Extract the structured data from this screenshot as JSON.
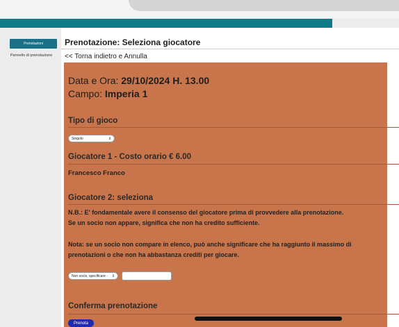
{
  "sidebar": {
    "button_label": "Prenotazioni",
    "link_label": "Pannello di prenotazione"
  },
  "main": {
    "title": "Prenotazione: Seleziona giocatore",
    "back_link": "<< Torna indietro e Annulla"
  },
  "booking": {
    "date_label": "Data e Ora: ",
    "date_value": "29/10/2024 H. 13.00",
    "campo_label": "Campo: ",
    "campo_value": "Imperia 1"
  },
  "tipo_gioco": {
    "heading": "Tipo di gioco",
    "selected": "Singolo"
  },
  "giocatore1": {
    "heading": "Giocatore 1 - Costo orario € 6.00",
    "name": "Francesco Franco"
  },
  "giocatore2": {
    "heading": "Giocatore 2: seleziona",
    "note1_line1": "N.B.: E' fondamentale avere il consenso del giocatore prima di provvedere alla prenotazione.",
    "note1_line2": "Se un socio non appare, significa che non ha credito sufficiente.",
    "note2_line1": "Nota: se un socio non compare in elenco, può anche significare che ha raggiunto il massimo di",
    "note2_line2": "prenotazioni o che non ha abbastanza crediti per giocare.",
    "select_value": "Non socio, specificare -"
  },
  "conferma": {
    "heading": "Conferma prenotazione",
    "button_label": "Prenota"
  },
  "colors": {
    "teal": "#0e7c86",
    "panel": "#c8754b",
    "button_blue": "#1f2bb0"
  }
}
